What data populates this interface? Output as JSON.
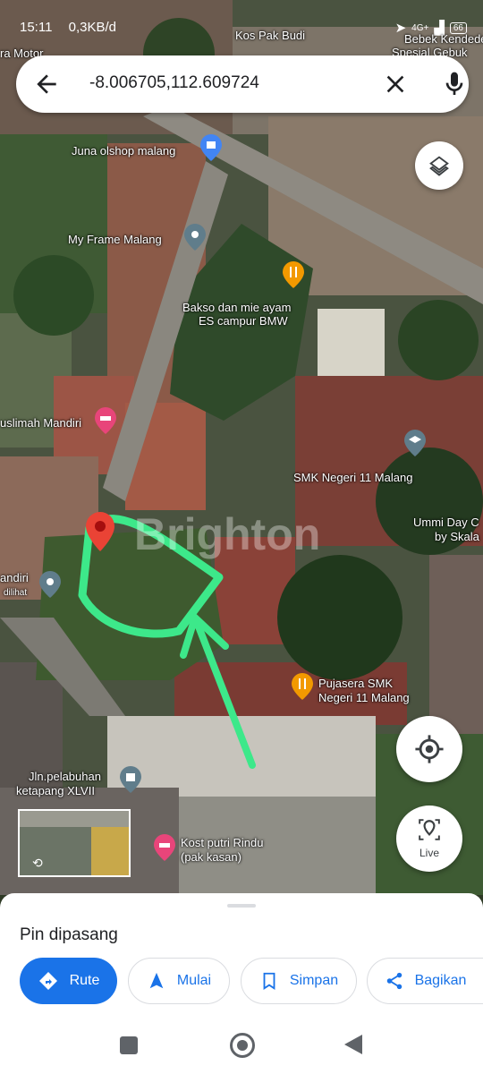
{
  "status_bar": {
    "time": "15:11",
    "speed": "0,3KB/d",
    "network": "4G+",
    "battery": "66"
  },
  "search": {
    "query": "-8.006705,112.609724"
  },
  "map": {
    "watermark": "Brighton",
    "labels": {
      "kos_pak_budi": "Kos Pak Budi",
      "bebek": "Bebek Kendedes",
      "bebek2": "Spesial Gebuk",
      "motor": "ra Motor",
      "juna": "Juna olshop malang",
      "myframe": "My Frame Malang",
      "bakso1": "Bakso dan mie ayam",
      "bakso2": "ES campur BMW",
      "muslimah": "uslimah Mandiri",
      "smk": "SMK Negeri 11 Malang",
      "ummi1": "Ummi Day C",
      "ummi2": "by Skala",
      "mandiri1": "andiri",
      "mandiri2": "dilihat",
      "pujasera1": "Pujasera SMK",
      "pujasera2": "Negeri 11 Malang",
      "jln1": "Jln.pelabuhan",
      "jln2": "ketapang XLVII",
      "kost1": "Kost putri Rindu",
      "kost2": "(pak kasan)"
    },
    "live_label": "Live"
  },
  "sheet": {
    "title": "Pin dipasang",
    "actions": [
      {
        "label": "Rute",
        "icon": "directions-icon"
      },
      {
        "label": "Mulai",
        "icon": "navigation-arrow-icon"
      },
      {
        "label": "Simpan",
        "icon": "bookmark-icon"
      },
      {
        "label": "Bagikan",
        "icon": "share-icon"
      }
    ]
  },
  "colors": {
    "accent": "#1a73e8",
    "pin_red": "#ea4335",
    "annotation_green": "#3de88a",
    "poi_orange": "#f29900",
    "poi_pink": "#e8457a"
  }
}
